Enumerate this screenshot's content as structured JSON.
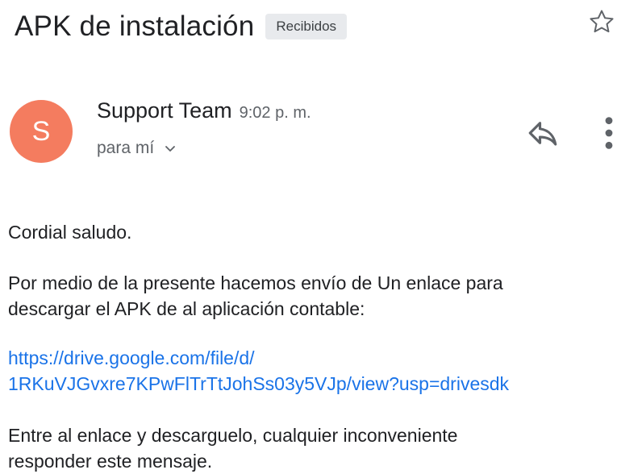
{
  "email": {
    "subject": "APK de instalación",
    "label": "Recibidos",
    "sender": {
      "avatar_letter": "S",
      "avatar_color": "#f47c5f",
      "name": "Support Team",
      "time": "9:02 p. m.",
      "recipient": "para mí"
    },
    "body": {
      "greeting": "Cordial saludo.",
      "paragraph1_line1": "Por medio de la presente hacemos envío de Un enlace para",
      "paragraph1_line2": "descargar el APK de al aplicación contable:",
      "link_line1": "https://drive.google.com/file/d/",
      "link_line2": "1RKuVJGvxre7KPwFlTrTtJohSs03y5VJp/view?usp=drivesdk",
      "paragraph2_line1": "Entre al enlace y descarguelo, cualquier inconveniente",
      "paragraph2_line2": "responder este mensaje."
    }
  },
  "icons": {
    "star": "star-outline-icon",
    "reply": "reply-icon",
    "more": "more-vert-icon",
    "chevron": "chevron-down-icon"
  },
  "colors": {
    "link": "#1a73e8",
    "text": "#202124",
    "secondary_text": "#5f6368",
    "chip_bg": "#e8eaed"
  }
}
